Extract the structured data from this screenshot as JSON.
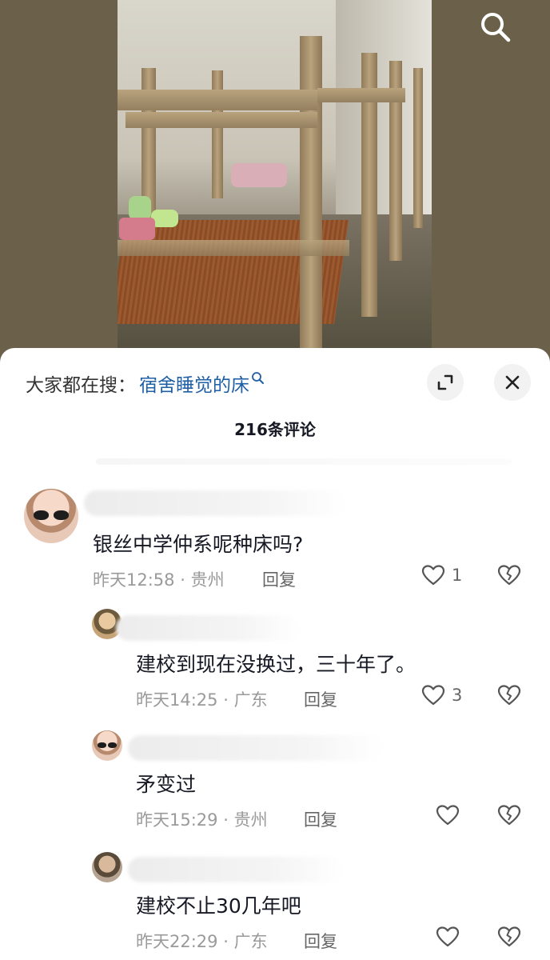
{
  "sheet": {
    "search_prefix": "大家都在搜：",
    "search_term": "宿舍睡觉的床",
    "comment_count": "216条评论"
  },
  "comments": [
    {
      "text": "银丝中学仲系呢种床吗?",
      "time": "昨天12:58",
      "location": "· 贵州",
      "reply_label": "回复",
      "likes": "1"
    },
    {
      "text": "建校到现在没换过，三十年了。",
      "time": "昨天14:25",
      "location": "· 广东",
      "reply_label": "回复",
      "likes": "3"
    },
    {
      "text": "矛变过",
      "time": "昨天15:29",
      "location": "· 贵州",
      "reply_label": "回复",
      "likes": ""
    },
    {
      "text": "建校不止30几年吧",
      "time": "昨天22:29",
      "location": "· 广东",
      "reply_label": "回复",
      "likes": ""
    }
  ],
  "icons": {
    "search": "search-icon",
    "expand": "expand-icon",
    "close": "close-icon",
    "like": "heart-icon",
    "dislike": "broken-heart-icon"
  },
  "colors": {
    "search_term": "#1f5fa5",
    "meta": "#9a9a9a",
    "photo_bg": "#6b6049"
  }
}
